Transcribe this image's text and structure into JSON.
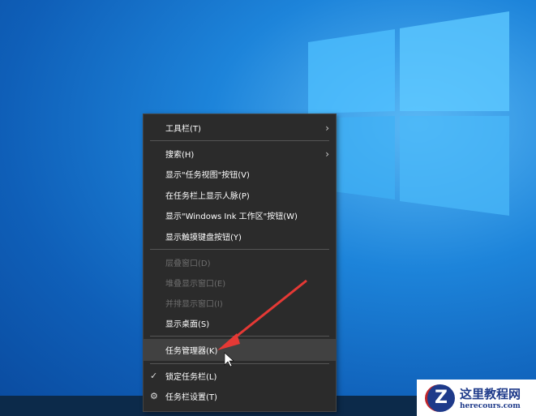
{
  "menu": {
    "items": [
      {
        "label": "工具栏(T)",
        "submenu": true
      },
      {
        "label": "搜索(H)",
        "submenu": true
      },
      {
        "label": "显示\"任务视图\"按钮(V)"
      },
      {
        "label": "在任务栏上显示人脉(P)"
      },
      {
        "label": "显示\"Windows Ink 工作区\"按钮(W)"
      },
      {
        "label": "显示触摸键盘按钮(Y)"
      },
      {
        "label": "层叠窗口(D)",
        "disabled": true
      },
      {
        "label": "堆叠显示窗口(E)",
        "disabled": true
      },
      {
        "label": "并排显示窗口(I)",
        "disabled": true
      },
      {
        "label": "显示桌面(S)"
      },
      {
        "label": "任务管理器(K)",
        "highlighted": true
      },
      {
        "label": "锁定任务栏(L)",
        "checked": true
      },
      {
        "label": "任务栏设置(T)",
        "icon": "gear-icon"
      }
    ]
  },
  "watermark": {
    "title": "这里教程网",
    "url": "herecours.com",
    "logo_letter": "Z"
  },
  "colors": {
    "menu_bg": "#2b2b2b",
    "highlight": "#414141",
    "arrow": "#e53935"
  }
}
